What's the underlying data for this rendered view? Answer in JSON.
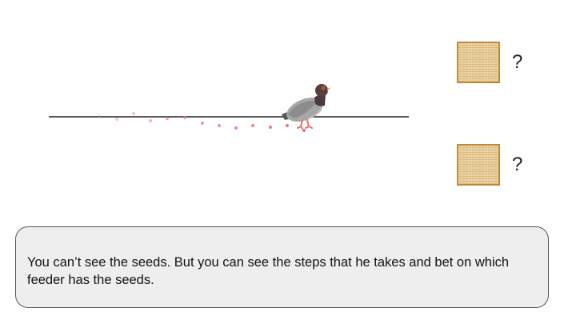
{
  "colors": {
    "line": "#222222",
    "step_dot": "#f07878",
    "feeder_border": "#c08a3e",
    "feeder_fill": "#e8cf9a",
    "panel_bg": "#eeeeee",
    "pigeon_body": "#a6a6a6",
    "pigeon_head": "#5a3d3d",
    "pigeon_beak": "#f0a020"
  },
  "feeders": [
    {
      "label": "?",
      "icon": "seed-feeder"
    },
    {
      "label": "?",
      "icon": "seed-feeder"
    }
  ],
  "steps_count": 13,
  "message": "You can’t see the seeds. But you can see the steps that he takes and bet on which feeder has the seeds."
}
